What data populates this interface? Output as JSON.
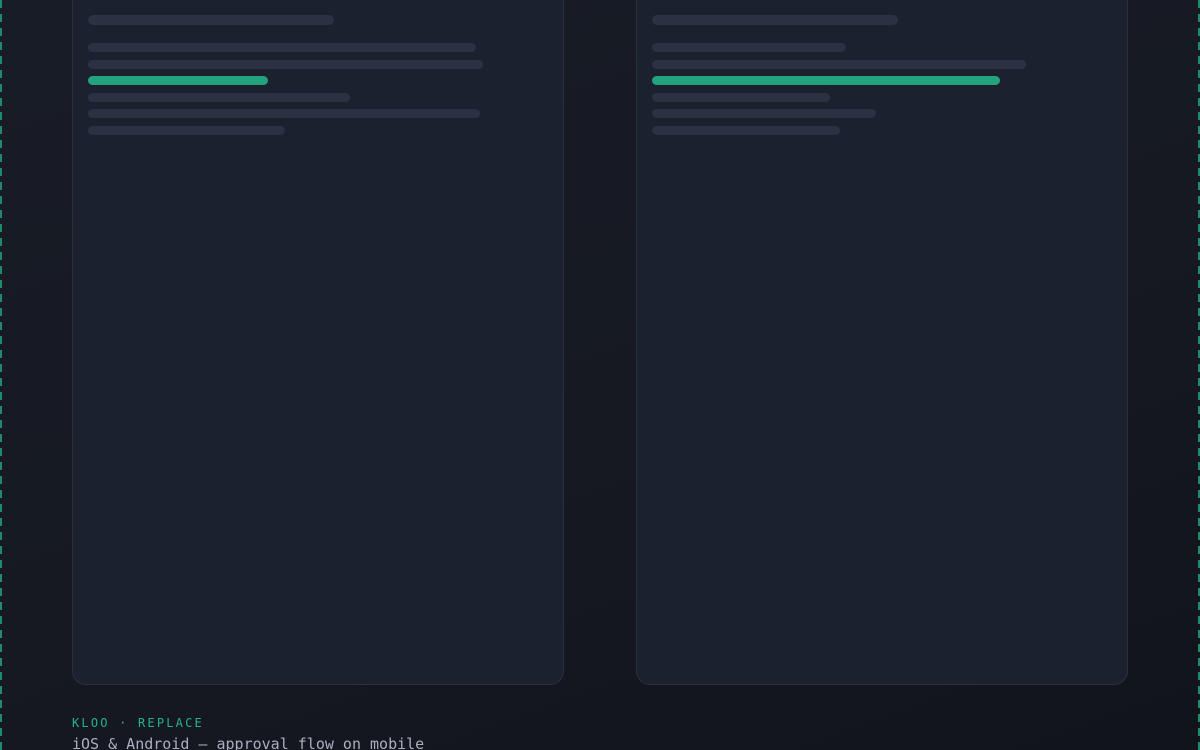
{
  "caption": {
    "eyebrow": "KLOO · REPLACE",
    "title": "iOS & Android — approval flow on mobile"
  },
  "colors": {
    "background": "#161922",
    "panel": "#1c2130",
    "panel_border": "#2a3040",
    "placeholder": "#2b3143",
    "accent": "#22a37e",
    "edge_dashes": "#1f8a6c"
  },
  "panels": [
    {
      "name": "left-screen",
      "highlighted_line_index": 2,
      "highlighted_line_fraction": 0.37
    },
    {
      "name": "right-screen",
      "highlighted_line_index": 2,
      "highlighted_line_fraction": 0.71
    }
  ]
}
